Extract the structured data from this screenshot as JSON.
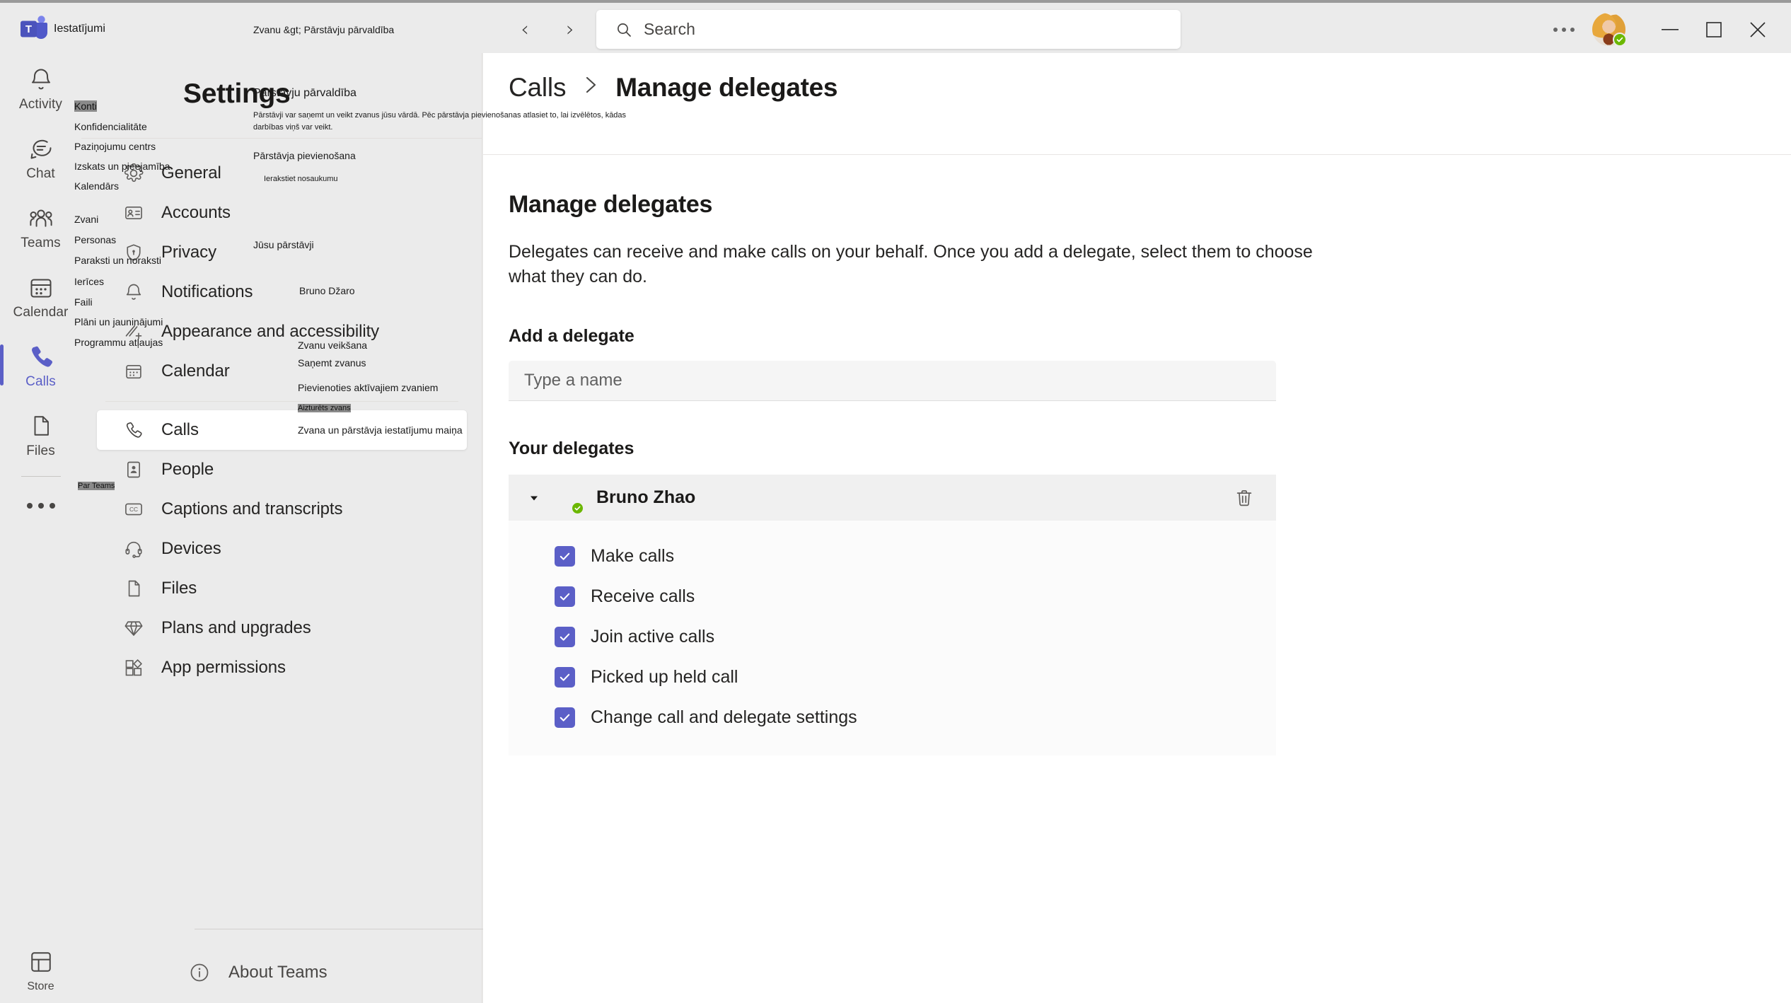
{
  "titlebar": {
    "logo_name": "teams-logo",
    "nav": {
      "back": "‹",
      "forward": "›"
    },
    "search": {
      "placeholder": "Search",
      "value": ""
    },
    "more_label": "…",
    "window": {
      "minimize": "—",
      "maximize": "□",
      "close": "✕"
    }
  },
  "rail": {
    "items": [
      {
        "label": "Activity",
        "icon": "bell-icon",
        "active": false
      },
      {
        "label": "Chat",
        "icon": "chat-icon",
        "active": false
      },
      {
        "label": "Teams",
        "icon": "teams-icon",
        "active": false
      },
      {
        "label": "Calendar",
        "icon": "calendar-icon",
        "active": false
      },
      {
        "label": "Calls",
        "icon": "phone-icon",
        "active": true
      },
      {
        "label": "Files",
        "icon": "file-icon",
        "active": false
      }
    ],
    "more": "more-apps-icon",
    "store": {
      "label": "Store",
      "icon": "store-icon"
    }
  },
  "settings": {
    "title": "Settings",
    "items": [
      {
        "label": "General",
        "icon": "gear-icon",
        "selected": false
      },
      {
        "label": "Accounts",
        "icon": "id-card-icon",
        "selected": false
      },
      {
        "label": "Privacy",
        "icon": "shield-lock-icon",
        "selected": false
      },
      {
        "label": "Notifications",
        "icon": "bell-icon",
        "selected": false
      },
      {
        "label": "Appearance and accessibility",
        "icon": "accessibility-icon",
        "selected": false
      },
      {
        "label": "Calendar",
        "icon": "calendar-icon",
        "selected": false
      }
    ],
    "items2": [
      {
        "label": "Calls",
        "icon": "phone-icon",
        "selected": true
      },
      {
        "label": "People",
        "icon": "person-card-icon",
        "selected": false
      },
      {
        "label": "Captions and transcripts",
        "icon": "cc-icon",
        "selected": false
      },
      {
        "label": "Devices",
        "icon": "headset-icon",
        "selected": false
      },
      {
        "label": "Files",
        "icon": "file-icon",
        "selected": false
      },
      {
        "label": "Plans and upgrades",
        "icon": "diamond-icon",
        "selected": false
      },
      {
        "label": "App permissions",
        "icon": "apps-icon",
        "selected": false
      }
    ],
    "about": {
      "label": "About Teams",
      "icon": "info-icon"
    }
  },
  "main": {
    "breadcrumb": {
      "parent": "Calls",
      "separator": "›",
      "current": "Manage delegates"
    },
    "heading": "Manage delegates",
    "description": "Delegates can receive and make calls on your behalf. Once you add a delegate, select them to choose what they can do.",
    "add_section_title": "Add a delegate",
    "add_input_placeholder": "Type a name",
    "add_input_value": "",
    "your_delegates_title": "Your delegates",
    "delegate": {
      "name": "Bruno Zhao",
      "presence": "available",
      "expanded": true,
      "delete_icon": "trash-icon",
      "caret_icon": "caret-down-icon",
      "permissions": [
        {
          "label": "Make calls",
          "checked": true
        },
        {
          "label": "Receive calls",
          "checked": true
        },
        {
          "label": "Join active calls",
          "checked": true
        },
        {
          "label": "Picked up held call",
          "checked": true
        },
        {
          "label": "Change call and delegate settings",
          "checked": true
        }
      ]
    }
  },
  "overlay_lv": {
    "window_title": "Iestatījumi",
    "breadcrumb": "Zvanu &gt;  Pārstāvju pārvaldība",
    "settings_menu": [
      "Konti",
      "Konfidencialitāte",
      "Paziņojumu centrs",
      "Izskats un pieejamība",
      "Kalendārs",
      "Zvani",
      "Personas",
      "Paraksti un noraksti",
      "Ierīces",
      "Faili",
      "Plāni un jauninājumi",
      "Programmu atļaujas"
    ],
    "about": "Par Teams",
    "heading": "Pārstāvju pārvaldība",
    "description_line1": "Pārstāvji var saņemt un veikt zvanus jūsu vārdā. Pēc pārstāvja pievienošanas atlasiet to, lai izvēlētos, kādas",
    "description_line2": "darbības viņš var veikt.",
    "add_section_title": "Pārstāvja pievienošana",
    "add_input_placeholder": "Ierakstiet nosaukumu",
    "your_delegates_title": "Jūsu pārstāvji",
    "delegate_name": "Bruno Džaro",
    "permissions": [
      "Zvanu veikšana",
      "Saņemt zvanus",
      "Pievienoties aktīvajiem zvaniem",
      "Aizturēts zvans",
      "Zvana un pārstāvja iestatījumu maiņa"
    ]
  },
  "colors": {
    "accent": "#5b5fc7",
    "presence_available": "#6bb700",
    "app_bg": "#ebebeb",
    "content_bg": "#ffffff"
  }
}
